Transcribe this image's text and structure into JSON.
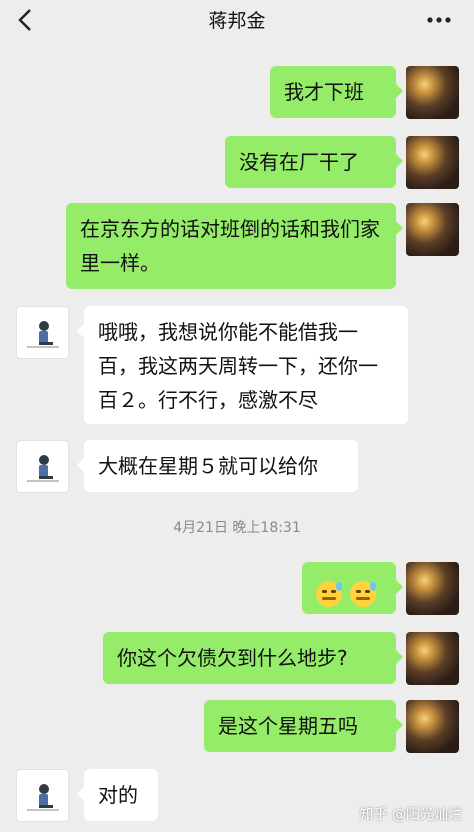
{
  "header": {
    "title": "蒋邦金"
  },
  "messages": [
    {
      "side": "out",
      "text": "我才下班"
    },
    {
      "side": "out",
      "text": "没有在厂干了"
    },
    {
      "side": "out",
      "text": "在京东方的话对班倒的话和我们家里一样。"
    },
    {
      "side": "in",
      "text": "哦哦，我想说你能不能借我一百，我这两天周转一下，还你一百２。行不行，感激不尽"
    },
    {
      "side": "in",
      "text": "大概在星期５就可以给你"
    },
    {
      "side": "time",
      "text": "4月21日 晚上18:31"
    },
    {
      "side": "out",
      "text": "",
      "emoji": [
        "sweat-smile-emoji",
        "sweat-smile-emoji"
      ]
    },
    {
      "side": "out",
      "text": "你这个欠债欠到什么地步?"
    },
    {
      "side": "out",
      "text": "是这个星期五吗"
    },
    {
      "side": "in",
      "text": "对的"
    }
  ],
  "watermark": "知乎 @阳光灿烂",
  "colors": {
    "background": "#ededed",
    "outgoing_bubble": "#95ec69",
    "incoming_bubble": "#ffffff"
  }
}
